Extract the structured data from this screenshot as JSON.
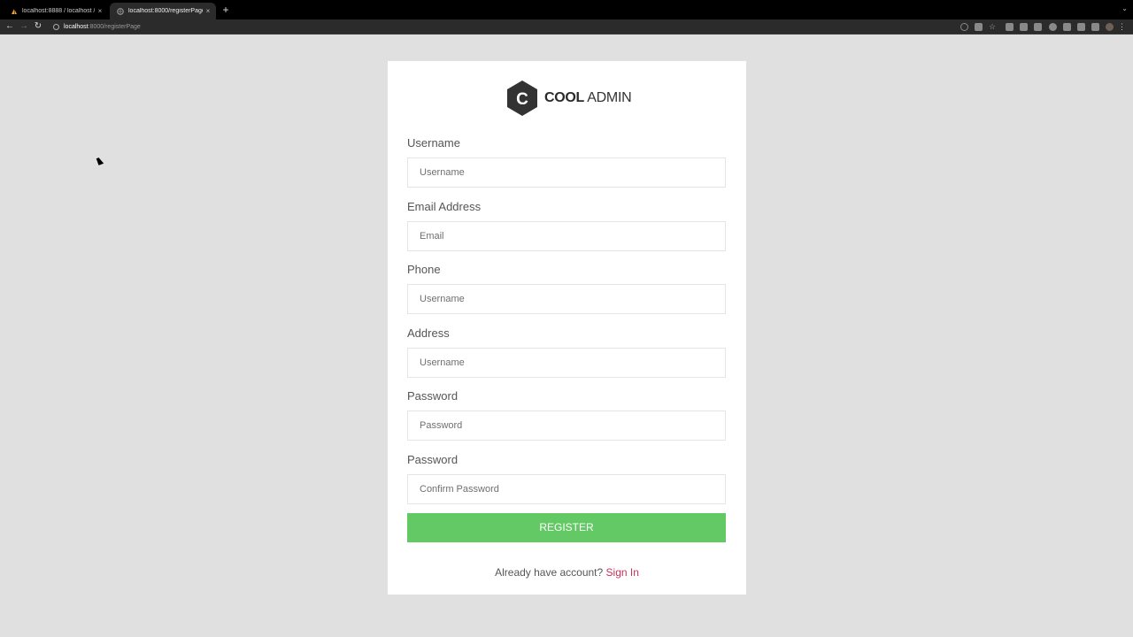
{
  "browser": {
    "tabs": [
      {
        "title": "localhost:8888 / localhost / p..."
      },
      {
        "title": "localhost:8000/registerPage"
      }
    ],
    "new_tab": "+",
    "close": "×",
    "url_host": "localhost",
    "url_path": ":8000/registerPage"
  },
  "brand": {
    "bold": "COOL",
    "light": "ADMIN",
    "mark": "C"
  },
  "form": {
    "fields": [
      {
        "label": "Username",
        "placeholder": "Username"
      },
      {
        "label": "Email Address",
        "placeholder": "Email"
      },
      {
        "label": "Phone",
        "placeholder": "Username"
      },
      {
        "label": "Address",
        "placeholder": "Username"
      },
      {
        "label": "Password",
        "placeholder": "Password"
      },
      {
        "label": "Password",
        "placeholder": "Confirm Password"
      }
    ],
    "submit_label": "REGISTER",
    "footer_text": "Already have account? ",
    "footer_link": "Sign In"
  },
  "colors": {
    "background": "#e0e0e0",
    "button": "#63c964",
    "link": "#c8305a"
  }
}
